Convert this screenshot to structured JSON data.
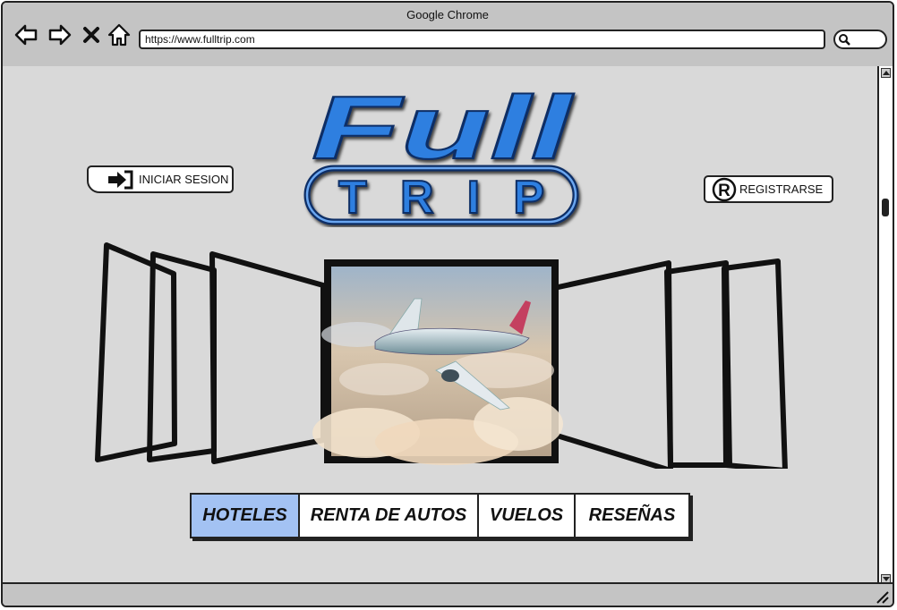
{
  "window": {
    "title": "Google Chrome"
  },
  "browser": {
    "url": "https://www.fulltrip.com",
    "buttons": {
      "back": "arrow-left-icon",
      "forward": "arrow-right-icon",
      "close": "close-icon",
      "home": "home-icon"
    }
  },
  "header": {
    "logo_top": "Full",
    "logo_bottom": "TRIP",
    "login_label": "INICIAR SESION",
    "register_label": "REGISTRARSE"
  },
  "tabs": [
    {
      "label": "HOTELES",
      "active": true
    },
    {
      "label": "RENTA DE AUTOS",
      "active": false
    },
    {
      "label": "VUELOS",
      "active": false
    },
    {
      "label": "RESEÑAS",
      "active": false
    }
  ],
  "colors": {
    "logo_blue": "#2f7fe0",
    "active_tab": "#a3c2f3",
    "chrome_gray": "#c4c4c4",
    "page_bg": "#d9d9d9"
  }
}
